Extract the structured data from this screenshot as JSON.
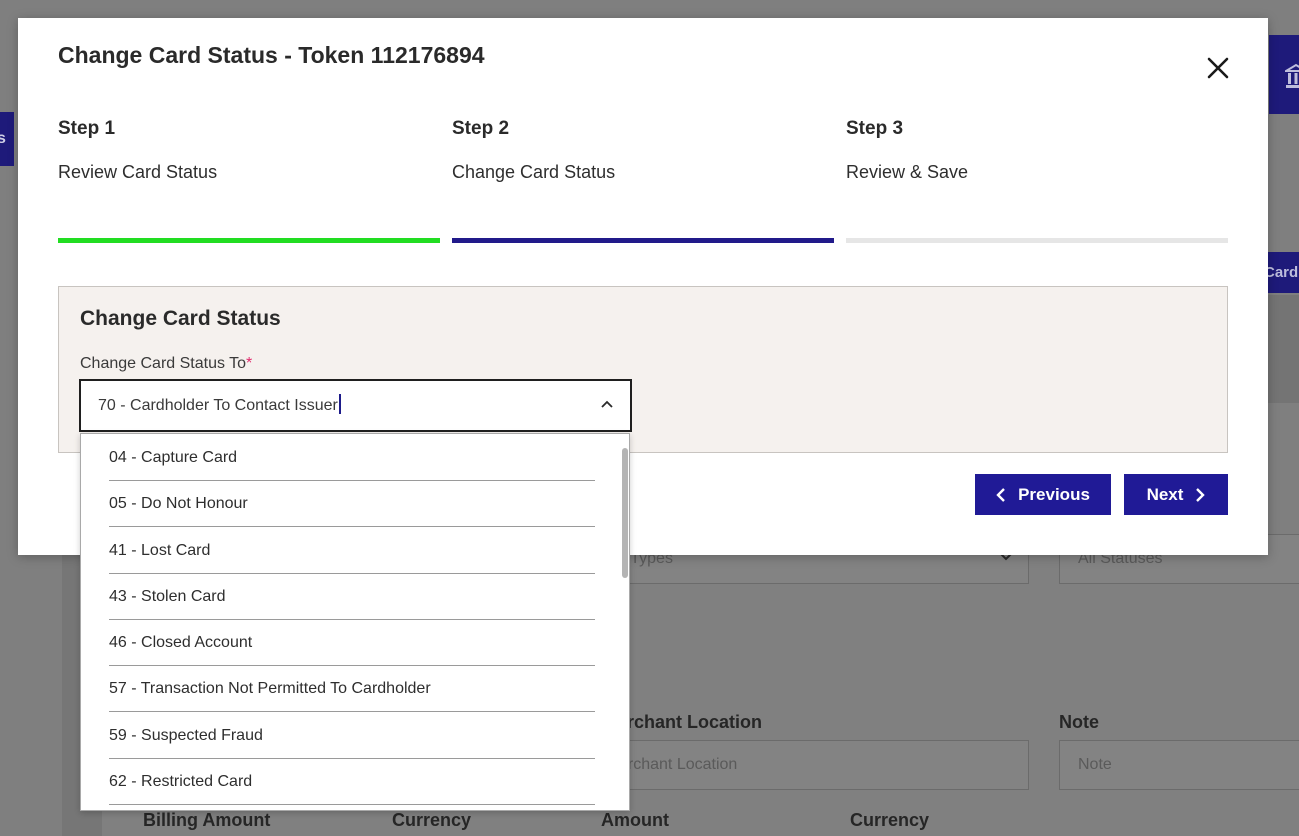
{
  "modal": {
    "title": "Change Card Status - Token 112176894"
  },
  "steps": [
    {
      "num": "Step 1",
      "label": "Review Card Status",
      "color": "#22dd22"
    },
    {
      "num": "Step 2",
      "label": "Change Card Status",
      "color": "#211a8a"
    },
    {
      "num": "Step 3",
      "label": "Review & Save",
      "color": "#e6e6e6"
    }
  ],
  "section": {
    "title": "Change Card Status",
    "field_label": "Change Card Status To",
    "required_mark": "*",
    "selected_value": "70 - Cardholder To Contact Issuer"
  },
  "dropdown": {
    "options": [
      "04 - Capture Card",
      "05 - Do Not Honour",
      "41 - Lost Card",
      "43 - Stolen Card",
      "46 - Closed Account",
      "57 - Transaction Not Permitted To Cardholder",
      "59 - Suspected Fraud",
      "62 - Restricted Card"
    ]
  },
  "buttons": {
    "previous": "Previous",
    "next": "Next"
  },
  "background": {
    "left_tab": "s",
    "right_tab": "Card",
    "type_select": "ll Types",
    "status_select": "All Statuses",
    "merchant_location_label": "erchant Location",
    "merchant_location_placeholder": "erchant Location",
    "note_label": "Note",
    "note_placeholder": "Note",
    "billing_amount_label": "Billing Amount",
    "currency_label_1": "Currency",
    "amount_label": "Amount",
    "currency_label_2": "Currency"
  },
  "colors": {
    "primary": "#201a96",
    "step_done": "#22dd22",
    "step_active": "#211a8a",
    "required": "#e02a6c"
  }
}
